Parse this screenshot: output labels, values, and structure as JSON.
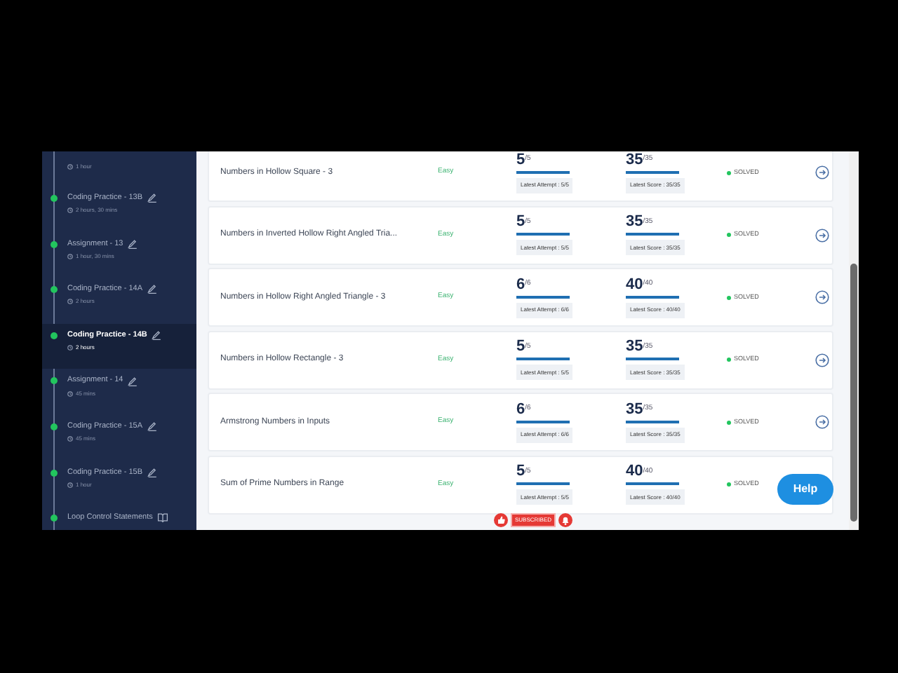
{
  "sidebar": {
    "items": [
      {
        "duration": "1 hour",
        "selected": false
      },
      {
        "title": "Coding Practice - 13B",
        "duration": "2 hours, 30 mins",
        "kind": "edit",
        "selected": false
      },
      {
        "title": "Assignment - 13",
        "duration": "1 hour, 30 mins",
        "kind": "edit",
        "selected": false
      },
      {
        "title": "Coding Practice - 14A",
        "duration": "2 hours",
        "kind": "edit",
        "selected": false
      },
      {
        "title": "Coding Practice - 14B",
        "duration": "2 hours",
        "kind": "edit",
        "selected": true
      },
      {
        "title": "Assignment - 14",
        "duration": "45 mins",
        "kind": "edit",
        "selected": false
      },
      {
        "title": "Coding Practice - 15A",
        "duration": "45 mins",
        "kind": "edit",
        "selected": false
      },
      {
        "title": "Coding Practice - 15B",
        "duration": "1 hour",
        "kind": "edit",
        "selected": false
      },
      {
        "title": "Loop Control Statements",
        "kind": "reading",
        "selected": false
      }
    ]
  },
  "problems": [
    {
      "title": "Numbers in Hollow Square - 3",
      "difficulty": "Easy",
      "attempt": {
        "score": "5",
        "total": "/5",
        "level": 1,
        "label": "Latest Attempt : 5/5"
      },
      "points": {
        "score": "35",
        "total": "/35",
        "level": 1,
        "label": "Latest Score : 35/35"
      },
      "status": "SOLVED"
    },
    {
      "title": "Numbers in Inverted Hollow Right Angled Tria...",
      "difficulty": "Easy",
      "attempt": {
        "score": "5",
        "total": "/5",
        "level": 1,
        "label": "Latest Attempt : 5/5"
      },
      "points": {
        "score": "35",
        "total": "/35",
        "level": 1,
        "label": "Latest Score : 35/35"
      },
      "status": "SOLVED"
    },
    {
      "title": "Numbers in Hollow Right Angled Triangle - 3",
      "difficulty": "Easy",
      "attempt": {
        "score": "6",
        "total": "/6",
        "level": 1,
        "label": "Latest Attempt : 6/6"
      },
      "points": {
        "score": "40",
        "total": "/40",
        "level": 1,
        "label": "Latest Score : 40/40"
      },
      "status": "SOLVED"
    },
    {
      "title": "Numbers in Hollow Rectangle - 3",
      "difficulty": "Easy",
      "attempt": {
        "score": "5",
        "total": "/5",
        "level": 1,
        "label": "Latest Attempt : 5/5"
      },
      "points": {
        "score": "35",
        "total": "/35",
        "level": 1,
        "label": "Latest Score : 35/35"
      },
      "status": "SOLVED"
    },
    {
      "title": "Armstrong Numbers in Inputs",
      "difficulty": "Easy",
      "attempt": {
        "score": "6",
        "total": "/6",
        "level": 1,
        "label": "Latest Attempt : 6/6"
      },
      "points": {
        "score": "35",
        "total": "/35",
        "level": 1,
        "label": "Latest Score : 35/35"
      },
      "status": "SOLVED"
    },
    {
      "title": "Sum of Prime Numbers in Range",
      "difficulty": "Easy",
      "attempt": {
        "score": "5",
        "total": "/5",
        "level": 1,
        "label": "Latest Attempt : 5/5"
      },
      "points": {
        "score": "40",
        "total": "/40",
        "level": 1,
        "label": "Latest Score : 40/40"
      },
      "status": "SOLVED"
    }
  ],
  "help_button": {
    "label": "Help"
  },
  "subscribe_overlay": {
    "label": "SUBSCRIBED"
  }
}
